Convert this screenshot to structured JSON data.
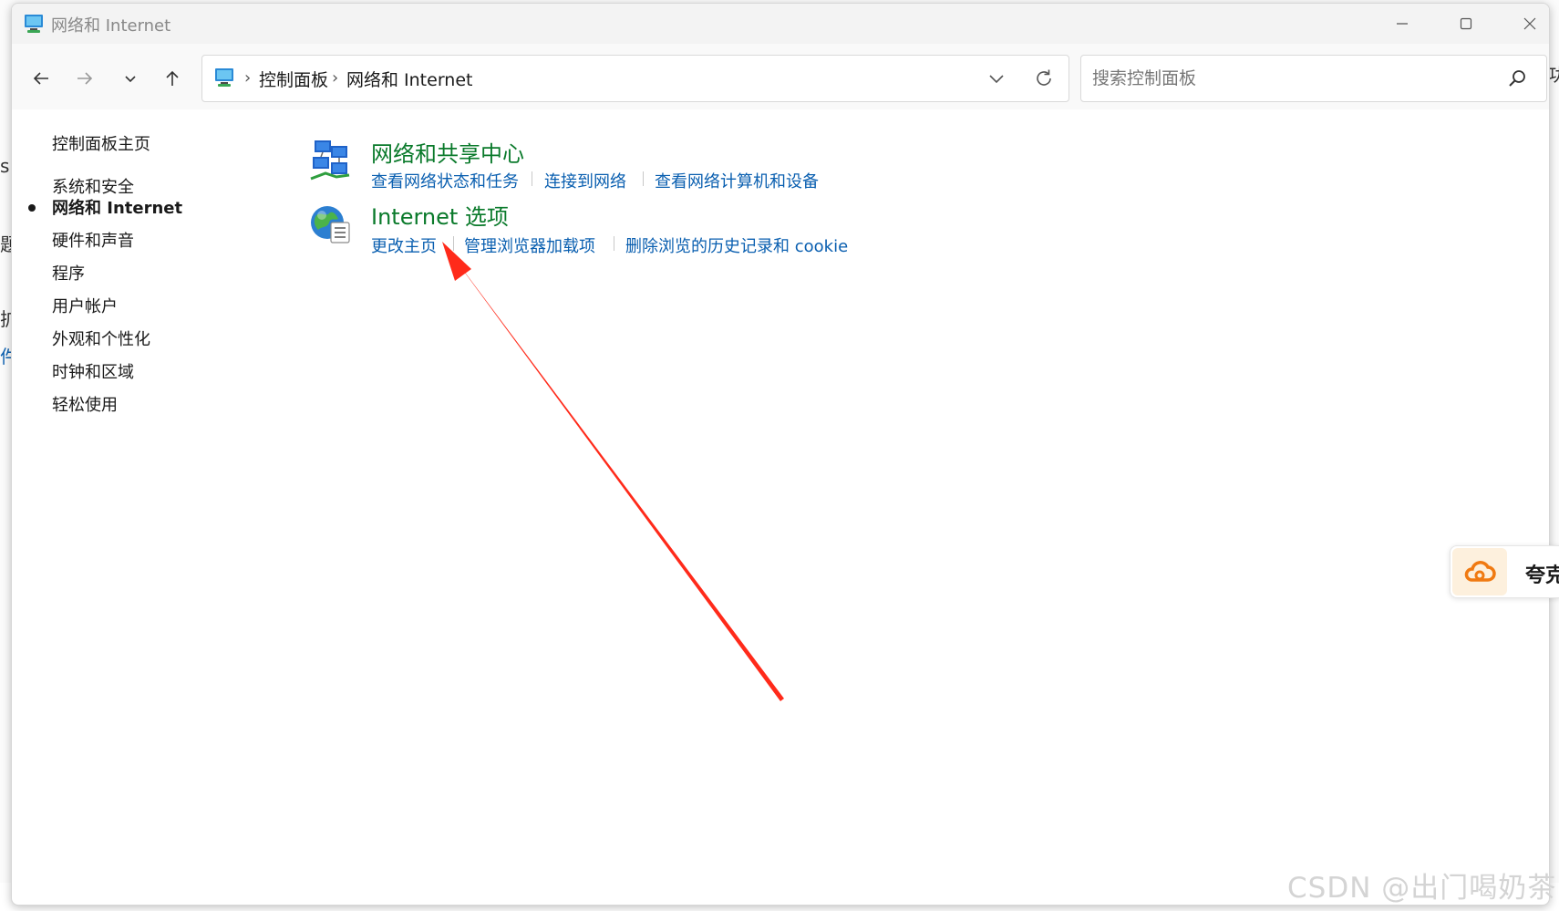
{
  "window": {
    "title": "网络和 Internet",
    "controls": {
      "minimize": "minimize-icon",
      "maximize": "maximize-icon",
      "close": "close-icon"
    }
  },
  "address_bar": {
    "breadcrumbs": [
      "控制面板",
      "网络和 Internet"
    ]
  },
  "search": {
    "placeholder": "搜索控制面板"
  },
  "sidebar": {
    "home": "控制面板主页",
    "items": [
      "系统和安全",
      "网络和 Internet",
      "硬件和声音",
      "程序",
      "用户帐户",
      "外观和个性化",
      "时钟和区域",
      "轻松使用"
    ],
    "active_index": 1
  },
  "categories": [
    {
      "title": "网络和共享中心",
      "icon": "network-sharing-icon",
      "links": [
        "查看网络状态和任务",
        "连接到网络",
        "查看网络计算机和设备"
      ]
    },
    {
      "title": "Internet 选项",
      "icon": "internet-options-globe-icon",
      "links": [
        "更改主页",
        "管理浏览器加载项",
        "删除浏览的历史记录和 cookie"
      ]
    }
  ],
  "annotation": {
    "arrow_color": "#ff2a1a"
  },
  "side_widget": {
    "label": "夸克"
  },
  "background_fragments": [
    "s",
    "题",
    "扩",
    "件",
    "功"
  ],
  "watermark": "CSDN @出门喝奶茶",
  "colors": {
    "category_title": "#0a7a2b",
    "link": "#0a5fb0"
  }
}
